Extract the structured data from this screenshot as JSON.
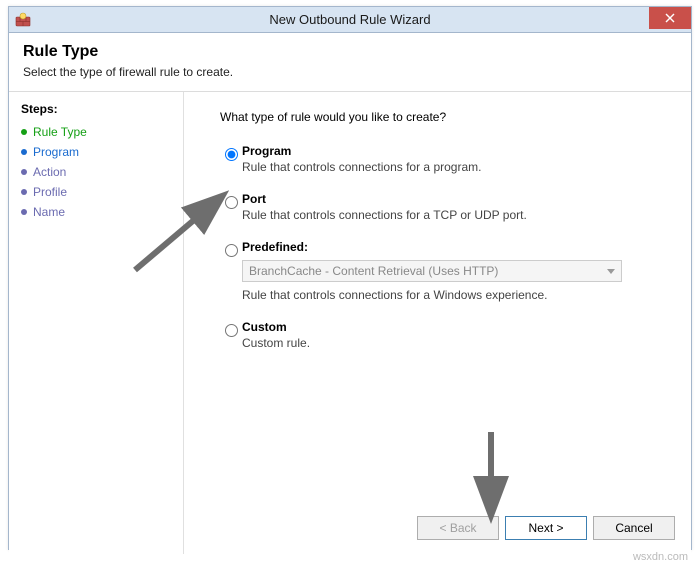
{
  "window": {
    "title": "New Outbound Rule Wizard"
  },
  "header": {
    "title": "Rule Type",
    "subtitle": "Select the type of firewall rule to create."
  },
  "sidebar": {
    "label": "Steps:",
    "items": [
      {
        "label": "Rule Type"
      },
      {
        "label": "Program"
      },
      {
        "label": "Action"
      },
      {
        "label": "Profile"
      },
      {
        "label": "Name"
      }
    ]
  },
  "content": {
    "prompt": "What type of rule would you like to create?",
    "options": {
      "program": {
        "title": "Program",
        "desc": "Rule that controls connections for a program."
      },
      "port": {
        "title": "Port",
        "desc": "Rule that controls connections for a TCP or UDP port."
      },
      "predefined": {
        "title": "Predefined:",
        "combo": "BranchCache - Content Retrieval (Uses HTTP)",
        "desc": "Rule that controls connections for a Windows experience."
      },
      "custom": {
        "title": "Custom",
        "desc": "Custom rule."
      }
    }
  },
  "buttons": {
    "back": "< Back",
    "next": "Next >",
    "cancel": "Cancel"
  },
  "watermark": "wsxdn.com"
}
